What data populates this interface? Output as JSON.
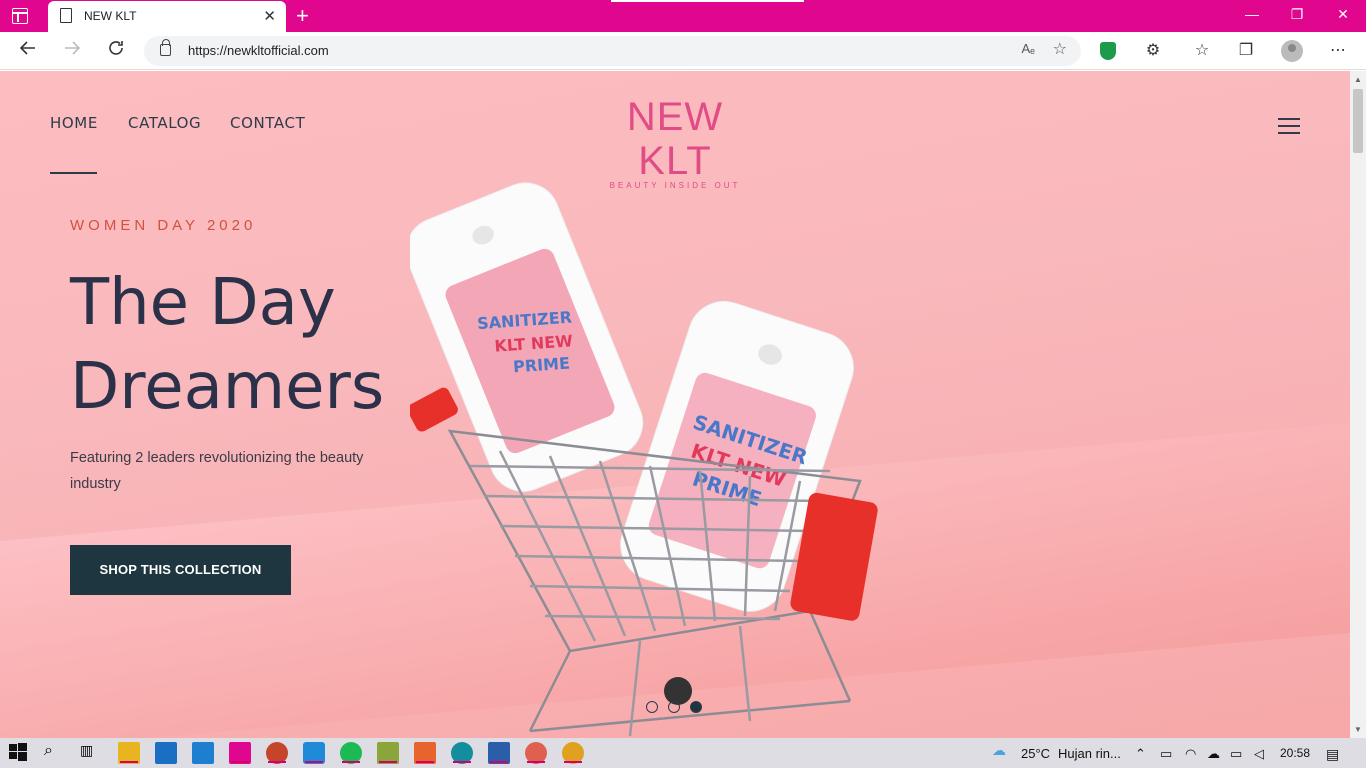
{
  "browser": {
    "tab_title": "NEW KLT",
    "url": "https://newkltofficial.com",
    "new_tab": "+",
    "close_tab": "✕",
    "read_aloud": "Aₑ",
    "controls": {
      "minimize": "—",
      "maximize": "❐",
      "close": "✕"
    }
  },
  "site": {
    "nav": [
      "HOME",
      "CATALOG",
      "CONTACT"
    ],
    "logo": {
      "brand": "NEW KLT",
      "tagline": "BEAUTY INSIDE OUT"
    },
    "hero": {
      "eyebrow": "WOMEN DAY 2020",
      "headline": "The Day Dreamers",
      "description": "Featuring 2 leaders revolutionizing the beauty industry",
      "cta": "SHOP THIS COLLECTION",
      "product_label_1": "SANITIZER",
      "product_label_2": "KLT NEW",
      "product_label_3": "PRIME"
    },
    "slider": {
      "count": 3,
      "active": 3
    }
  },
  "taskbar": {
    "weather": "25°C",
    "weather_text": "Hujan rin...",
    "time": "20:58"
  },
  "colors": {
    "titlebar": "#e0078e",
    "hero_bg": "#f9b8bc",
    "cta_bg": "#1e3640",
    "logo": "#e14b86",
    "eyebrow": "#d1523e"
  }
}
